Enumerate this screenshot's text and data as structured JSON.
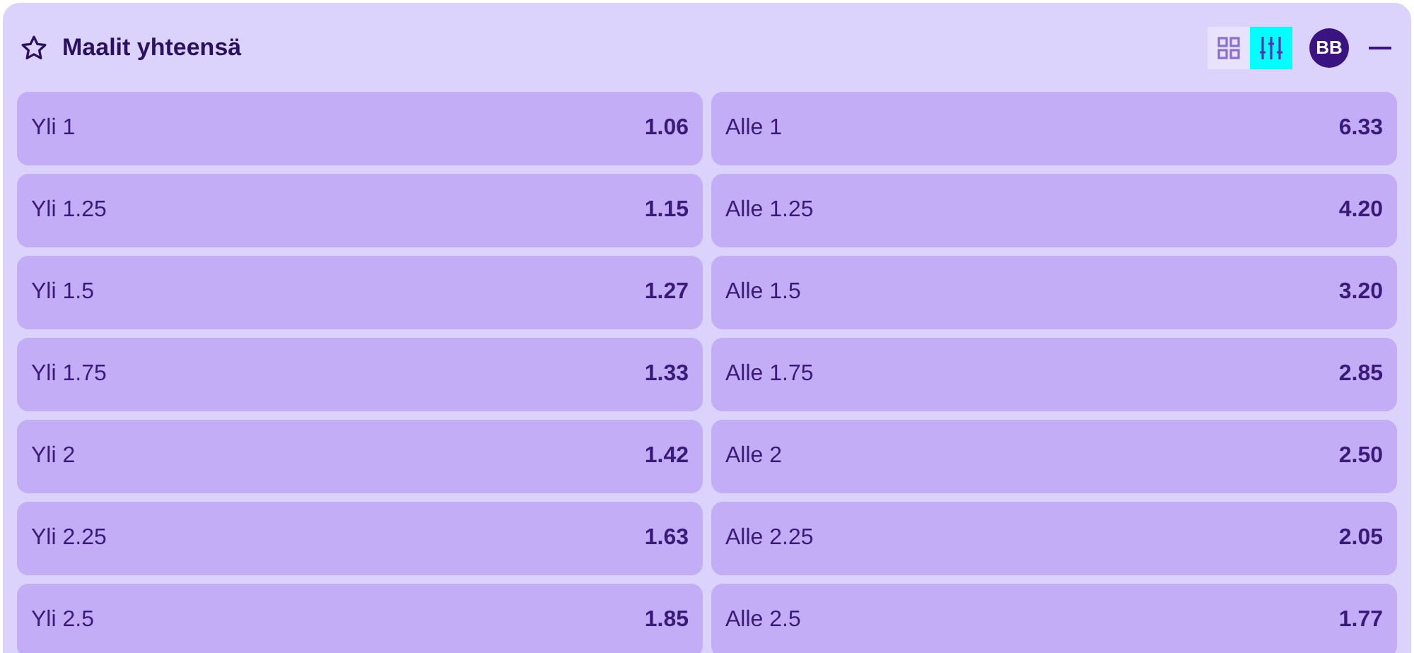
{
  "title": "Maalit yhteensä",
  "view_modes": [
    {
      "kind": "grid",
      "selected": false
    },
    {
      "kind": "sliders",
      "selected": true
    }
  ],
  "badge": "BB",
  "rows": [
    [
      {
        "label": "Yli 1",
        "odds": "1.06"
      },
      {
        "label": "Alle 1",
        "odds": "6.33"
      }
    ],
    [
      {
        "label": "Yli 1.25",
        "odds": "1.15"
      },
      {
        "label": "Alle 1.25",
        "odds": "4.20"
      }
    ],
    [
      {
        "label": "Yli 1.5",
        "odds": "1.27"
      },
      {
        "label": "Alle 1.5",
        "odds": "3.20"
      }
    ],
    [
      {
        "label": "Yli 1.75",
        "odds": "1.33"
      },
      {
        "label": "Alle 1.75",
        "odds": "2.85"
      }
    ],
    [
      {
        "label": "Yli 2",
        "odds": "1.42"
      },
      {
        "label": "Alle 2",
        "odds": "2.50"
      }
    ],
    [
      {
        "label": "Yli 2.25",
        "odds": "1.63"
      },
      {
        "label": "Alle 2.25",
        "odds": "2.05"
      }
    ],
    [
      {
        "label": "Yli 2.5",
        "odds": "1.85"
      },
      {
        "label": "Alle 2.5",
        "odds": "1.77"
      }
    ]
  ]
}
